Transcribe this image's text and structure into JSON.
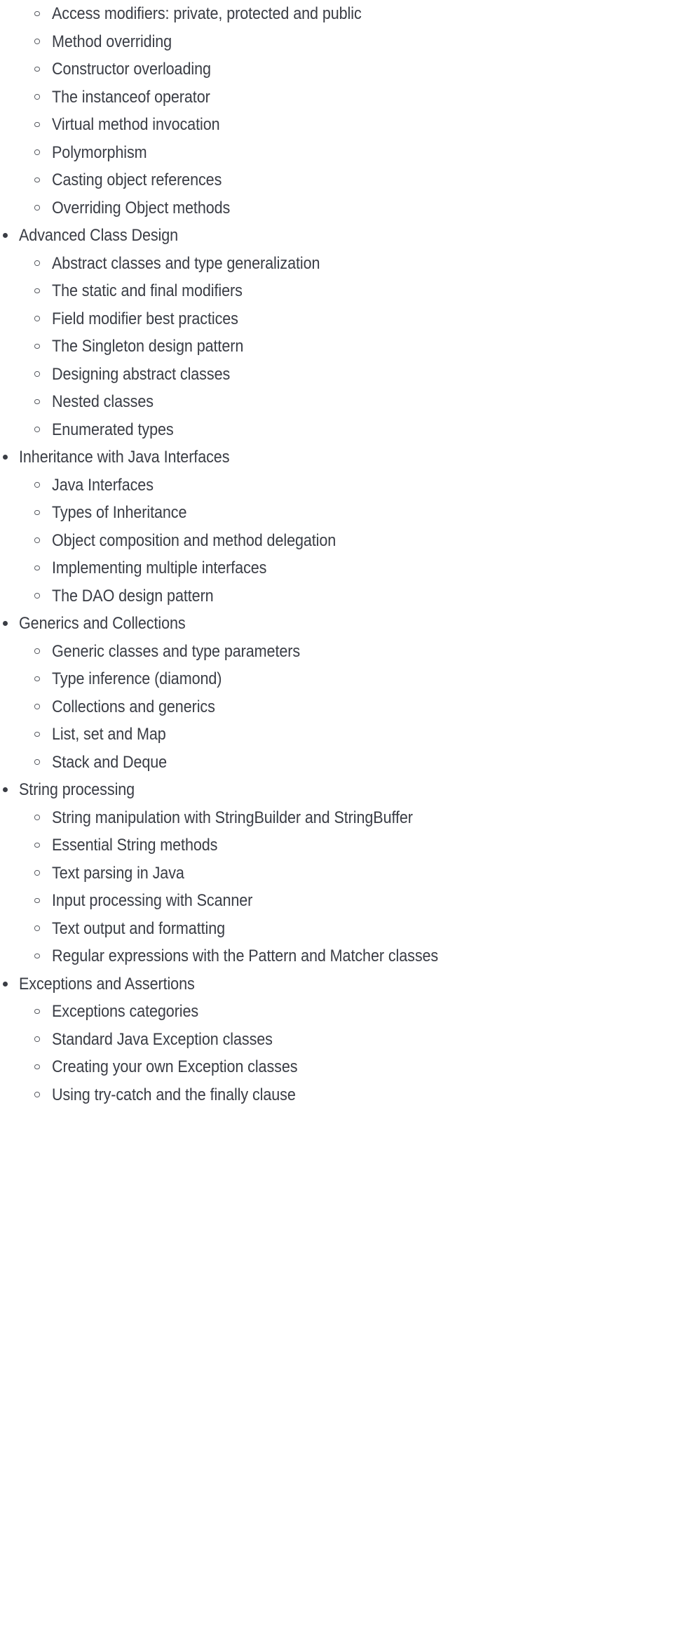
{
  "document": {
    "type": "course-outline",
    "background_color": "#ffffff",
    "text_color": "#3a3d45",
    "level1_marker": "filled-bullet",
    "level2_marker": "hollow-circle"
  },
  "outline": {
    "items": [
      {
        "level": 2,
        "text": "Access modifiers: private, protected and public"
      },
      {
        "level": 2,
        "text": "Method overriding"
      },
      {
        "level": 2,
        "text": "Constructor overloading"
      },
      {
        "level": 2,
        "text": "The instanceof operator"
      },
      {
        "level": 2,
        "text": "Virtual method invocation"
      },
      {
        "level": 2,
        "text": "Polymorphism"
      },
      {
        "level": 2,
        "text": "Casting object references"
      },
      {
        "level": 2,
        "text": "Overriding Object methods"
      },
      {
        "level": 1,
        "text": "Advanced Class Design"
      },
      {
        "level": 2,
        "text": "Abstract classes and type generalization"
      },
      {
        "level": 2,
        "text": "The static and final modifiers"
      },
      {
        "level": 2,
        "text": "Field modifier best practices"
      },
      {
        "level": 2,
        "text": "The Singleton design pattern"
      },
      {
        "level": 2,
        "text": "Designing abstract classes"
      },
      {
        "level": 2,
        "text": "Nested classes"
      },
      {
        "level": 2,
        "text": "Enumerated types"
      },
      {
        "level": 1,
        "text": "Inheritance with Java Interfaces"
      },
      {
        "level": 2,
        "text": "Java Interfaces"
      },
      {
        "level": 2,
        "text": "Types of Inheritance"
      },
      {
        "level": 2,
        "text": "Object composition and method delegation"
      },
      {
        "level": 2,
        "text": "Implementing multiple interfaces"
      },
      {
        "level": 2,
        "text": "The DAO design pattern"
      },
      {
        "level": 1,
        "text": "Generics and Collections"
      },
      {
        "level": 2,
        "text": "Generic classes and type parameters"
      },
      {
        "level": 2,
        "text": "Type inference (diamond)"
      },
      {
        "level": 2,
        "text": "Collections and generics"
      },
      {
        "level": 2,
        "text": "List, set and Map"
      },
      {
        "level": 2,
        "text": "Stack and Deque"
      },
      {
        "level": 1,
        "text": "String processing"
      },
      {
        "level": 2,
        "text": "String manipulation with StringBuilder and StringBuffer"
      },
      {
        "level": 2,
        "text": "Essential String methods"
      },
      {
        "level": 2,
        "text": "Text parsing in Java"
      },
      {
        "level": 2,
        "text": "Input processing with Scanner"
      },
      {
        "level": 2,
        "text": "Text output and formatting"
      },
      {
        "level": 2,
        "text": "Regular expressions with the Pattern and Matcher classes"
      },
      {
        "level": 1,
        "text": "Exceptions and Assertions"
      },
      {
        "level": 2,
        "text": "Exceptions categories"
      },
      {
        "level": 2,
        "text": "Standard Java Exception classes"
      },
      {
        "level": 2,
        "text": "Creating your own Exception classes"
      },
      {
        "level": 2,
        "text": "Using try-catch and the finally clause"
      }
    ]
  }
}
